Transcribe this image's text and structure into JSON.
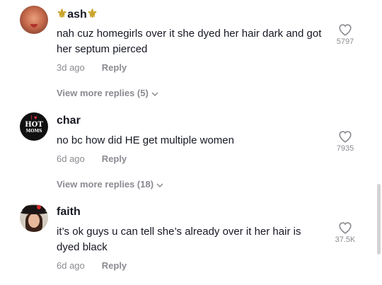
{
  "comments": [
    {
      "username": "ash",
      "text": "nah cuz homegirls over it she dyed her hair dark and got her septum pierced",
      "time": "3d ago",
      "reply": "Reply",
      "likes": "5797",
      "view_more": "View more replies (5)"
    },
    {
      "username": "char",
      "avatar_text_top": "I ♥",
      "avatar_text_mid": "HOT",
      "avatar_text_bottom": "MOMS",
      "text": "no bc how did HE get multiple women",
      "time": "6d ago",
      "reply": "Reply",
      "likes": "7935",
      "view_more": "View more replies (18)"
    },
    {
      "username": "faith",
      "text": "it’s ok guys u can tell she’s already over it her hair is dyed black",
      "time": "6d ago",
      "reply": "Reply",
      "likes": "37.5K"
    }
  ],
  "icons": {
    "like": "heart-outline-icon",
    "expand": "chevron-down-icon",
    "username_decoration": "fleur-de-lis-icon"
  },
  "colors": {
    "text": "#161823",
    "secondary": "#8a8b91",
    "decoration": "#c9a227"
  }
}
